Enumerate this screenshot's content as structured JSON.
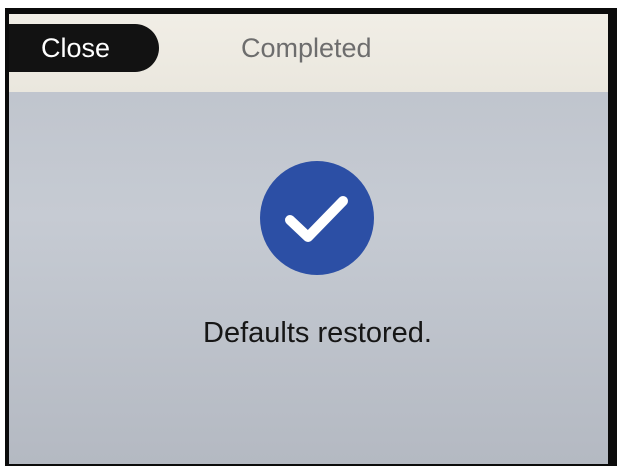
{
  "header": {
    "close_label": "Close",
    "title": "Completed"
  },
  "status": {
    "icon": "check-icon",
    "icon_color": "#2c4fa5",
    "message": "Defaults restored."
  }
}
